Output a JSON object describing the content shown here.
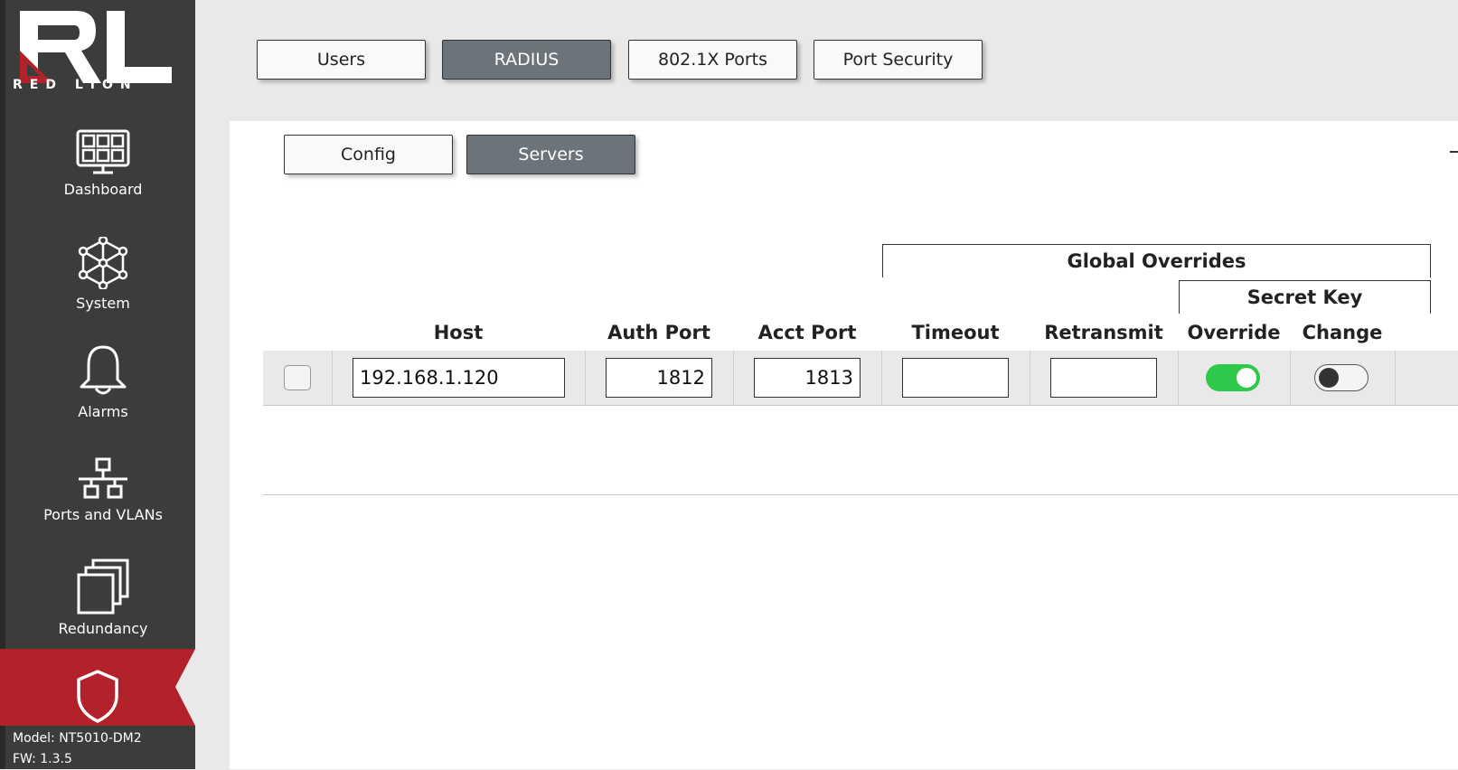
{
  "brand": {
    "name": "RED LION"
  },
  "sidebar": {
    "items": [
      {
        "label": "Dashboard",
        "icon": "dashboard-icon"
      },
      {
        "label": "System",
        "icon": "system-network-icon"
      },
      {
        "label": "Alarms",
        "icon": "bell-icon"
      },
      {
        "label": "Ports and VLANs",
        "icon": "ports-vlan-icon"
      },
      {
        "label": "Redundancy",
        "icon": "redundancy-icon"
      },
      {
        "label": "",
        "icon": "shield-icon",
        "active": true
      }
    ],
    "model": "Model: NT5010-DM2",
    "fw": "FW: 1.3.5"
  },
  "tabs": [
    {
      "label": "Users",
      "active": false
    },
    {
      "label": "RADIUS",
      "active": true
    },
    {
      "label": "802.1X Ports",
      "active": false
    },
    {
      "label": "Port Security",
      "active": false
    }
  ],
  "subtabs": [
    {
      "label": "Config",
      "active": false
    },
    {
      "label": "Servers",
      "active": true
    }
  ],
  "table": {
    "group_global": "Global Overrides",
    "group_secret": "Secret Key",
    "columns": {
      "host": "Host",
      "auth_port": "Auth Port",
      "acct_port": "Acct Port",
      "timeout": "Timeout",
      "retransmit": "Retransmit",
      "override": "Override",
      "change": "Change"
    },
    "rows": [
      {
        "selected": false,
        "host": "192.168.1.120",
        "auth_port": "1812",
        "acct_port": "1813",
        "timeout": "",
        "retransmit": "",
        "override": true,
        "change": false
      }
    ]
  },
  "colors": {
    "sidebar_bg": "#3b3d3a",
    "accent_red": "#b3212a",
    "active_tab": "#6c747a",
    "toggle_on": "#2ec84a"
  }
}
